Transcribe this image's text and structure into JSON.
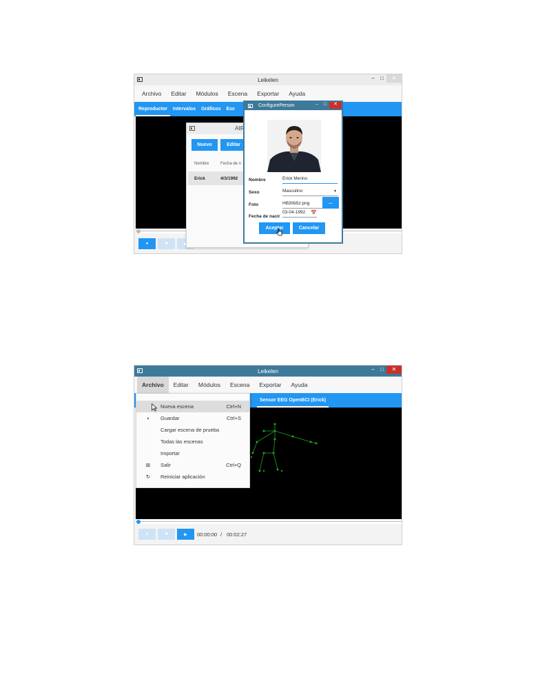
{
  "screenshot1": {
    "window_title": "Leikelen",
    "menu": [
      "Archivo",
      "Editar",
      "Módulos",
      "Escena",
      "Exportar",
      "Ayuda"
    ],
    "tabs": [
      "Reproductor",
      "Intervalos",
      "Gráficos",
      "Esc"
    ],
    "all_persons": {
      "title": "AllP",
      "new_button": "Nuevo",
      "edit_button": "Editar",
      "col_name": "Nombre",
      "col_date": "Fecha de n",
      "row_name": "Erick",
      "row_date": "4/3/1992"
    },
    "configure_person": {
      "title": "ConfigurePerson",
      "name_label": "Nombre",
      "name_value": "Erick Merino",
      "sex_label": "Sexo",
      "sex_value": "Masculino",
      "photo_label": "Foto",
      "photo_value": "HB30b5z.png",
      "browse_button": "...",
      "birth_label": "Fecha de nacir",
      "birth_value": "03-04-1992",
      "accept_button": "Aceptar",
      "cancel_button": "Cancelar"
    }
  },
  "screenshot2": {
    "window_title": "Leikelen",
    "menu": [
      "Archivo",
      "Editar",
      "Módulos",
      "Escena",
      "Exportar",
      "Ayuda"
    ],
    "active_menu": "Archivo",
    "tab_label": "Sensor EEG OpenBCI (Erick)",
    "dropdown": [
      {
        "label": "Nueva escena",
        "shortcut": "Ctrl+N",
        "icon": ""
      },
      {
        "label": "Guardar",
        "shortcut": "Ctrl+S",
        "icon": "save-icon"
      },
      {
        "label": "Cargar escena de prueba",
        "shortcut": "",
        "icon": ""
      },
      {
        "label": "Todas las escenas",
        "shortcut": "",
        "icon": ""
      },
      {
        "label": "Importar",
        "shortcut": "",
        "icon": ""
      },
      {
        "label": "Salir",
        "shortcut": "Ctrl+Q",
        "icon": "exit-icon"
      },
      {
        "label": "Reiniciar aplicación",
        "shortcut": "",
        "icon": "refresh-icon"
      }
    ],
    "time_current": "00:00:00",
    "time_separator": "/",
    "time_total": "00:02:27"
  },
  "colors": {
    "accent": "#2196f3",
    "title_dark": "#3d7a9a",
    "close_red": "#c9302c",
    "skeleton": "#1fa81f"
  }
}
